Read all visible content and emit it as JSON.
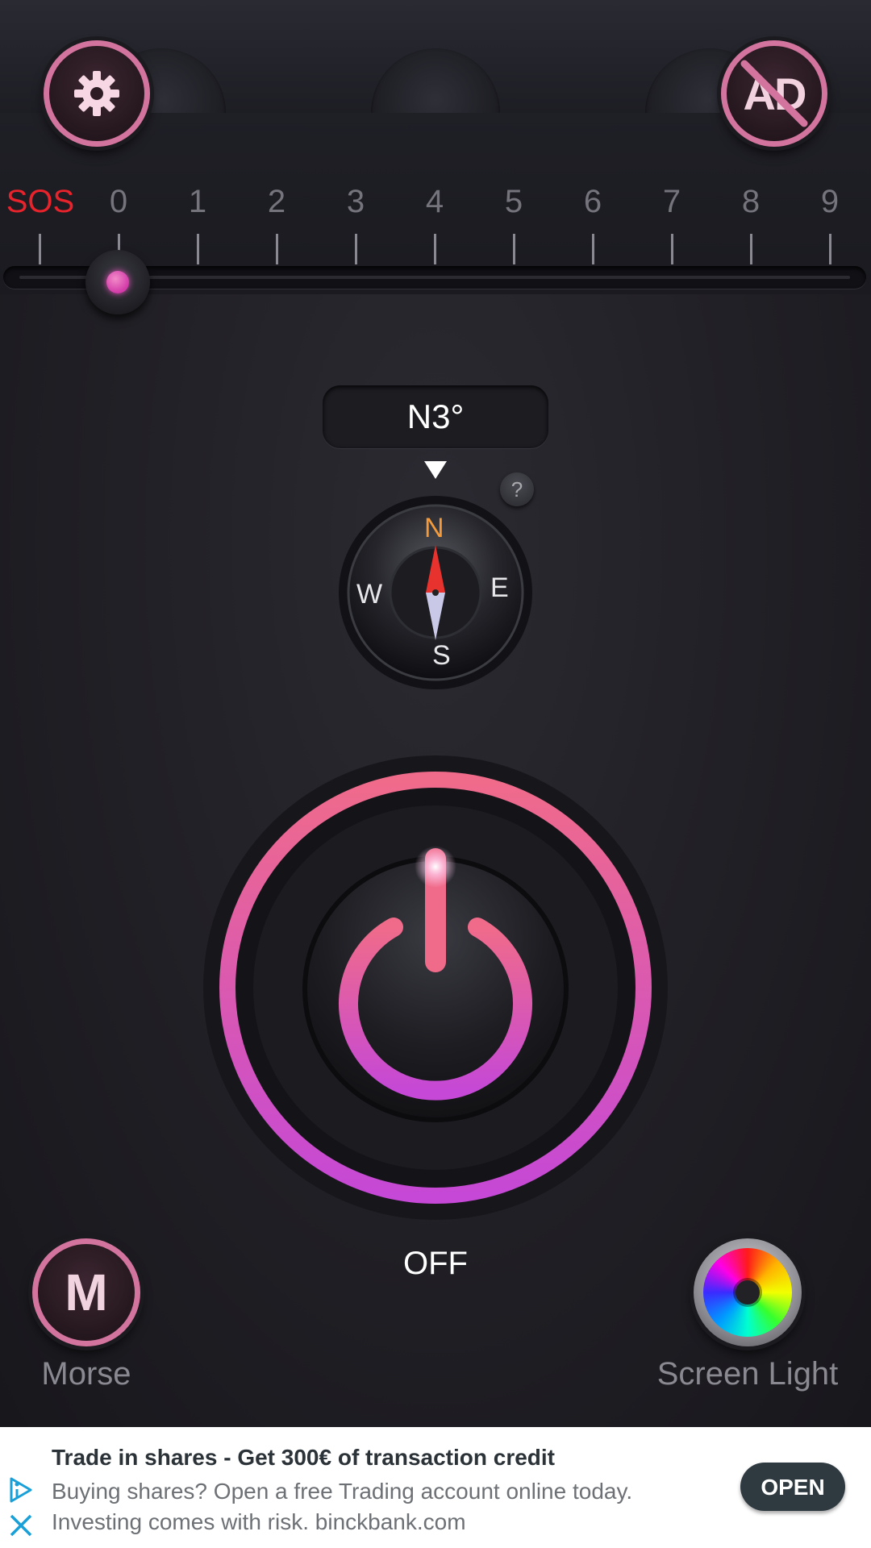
{
  "top_bar": {
    "settings_icon": "gear-icon",
    "remove_ads_label": "AD",
    "remove_ads_icon": "no-ads-icon"
  },
  "strobe_scale": {
    "labels": [
      "SOS",
      "0",
      "1",
      "2",
      "3",
      "4",
      "5",
      "6",
      "7",
      "8",
      "9"
    ],
    "selected": "0",
    "sos_color": "#e8232b"
  },
  "compass": {
    "heading": "N3°",
    "directions": {
      "north": "N",
      "east": "E",
      "south": "S",
      "west": "W"
    },
    "help_label": "?",
    "north_color": "#f39a3b"
  },
  "power": {
    "state": "OFF",
    "accent_color": "#d957c8",
    "icon": "power-icon"
  },
  "bottom": {
    "morse_letter": "M",
    "morse_label": "Morse",
    "screen_light_label": "Screen Light",
    "screen_light_icon": "color-wheel-icon"
  },
  "ad": {
    "title": "Trade in shares - Get 300€ of transaction credit",
    "line1": "Buying shares? Open a free Trading account online today.",
    "line2": "Investing comes with risk. binckbank.com",
    "open_label": "OPEN",
    "adchoices_icon": "adchoices-icon",
    "close_icon": "close-icon"
  }
}
